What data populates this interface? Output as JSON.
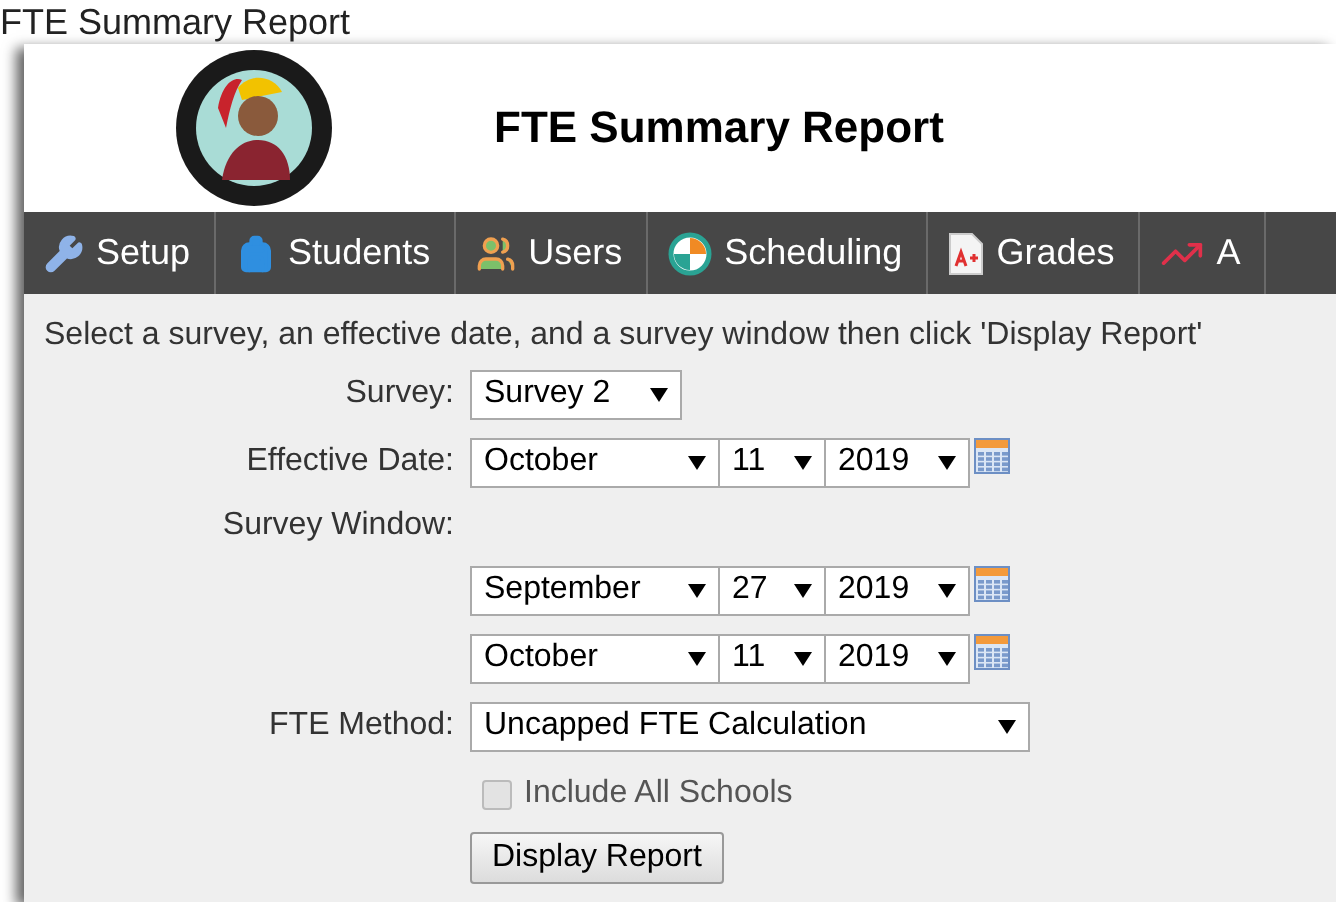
{
  "page_heading": "FTE Summary Report",
  "header": {
    "title": "FTE Summary Report"
  },
  "nav": [
    {
      "label": "Setup"
    },
    {
      "label": "Students"
    },
    {
      "label": "Users"
    },
    {
      "label": "Scheduling"
    },
    {
      "label": "Grades"
    },
    {
      "label": "A"
    }
  ],
  "form": {
    "instruction": "Select a survey, an effective date, and a survey window then click 'Display Report'",
    "survey": {
      "label": "Survey:",
      "value": "Survey 2"
    },
    "effective_date": {
      "label": "Effective Date:",
      "month": "October",
      "day": "11",
      "year": "2019"
    },
    "survey_window": {
      "label": "Survey Window:",
      "ranges": [
        {
          "month": "September",
          "day": "27",
          "year": "2019"
        },
        {
          "month": "October",
          "day": "11",
          "year": "2019"
        }
      ]
    },
    "fte_method": {
      "label": "FTE Method:",
      "value": "Uncapped FTE Calculation"
    },
    "include_all_schools": {
      "label": "Include All Schools",
      "checked": false,
      "disabled": true
    },
    "button": "Display Report"
  }
}
